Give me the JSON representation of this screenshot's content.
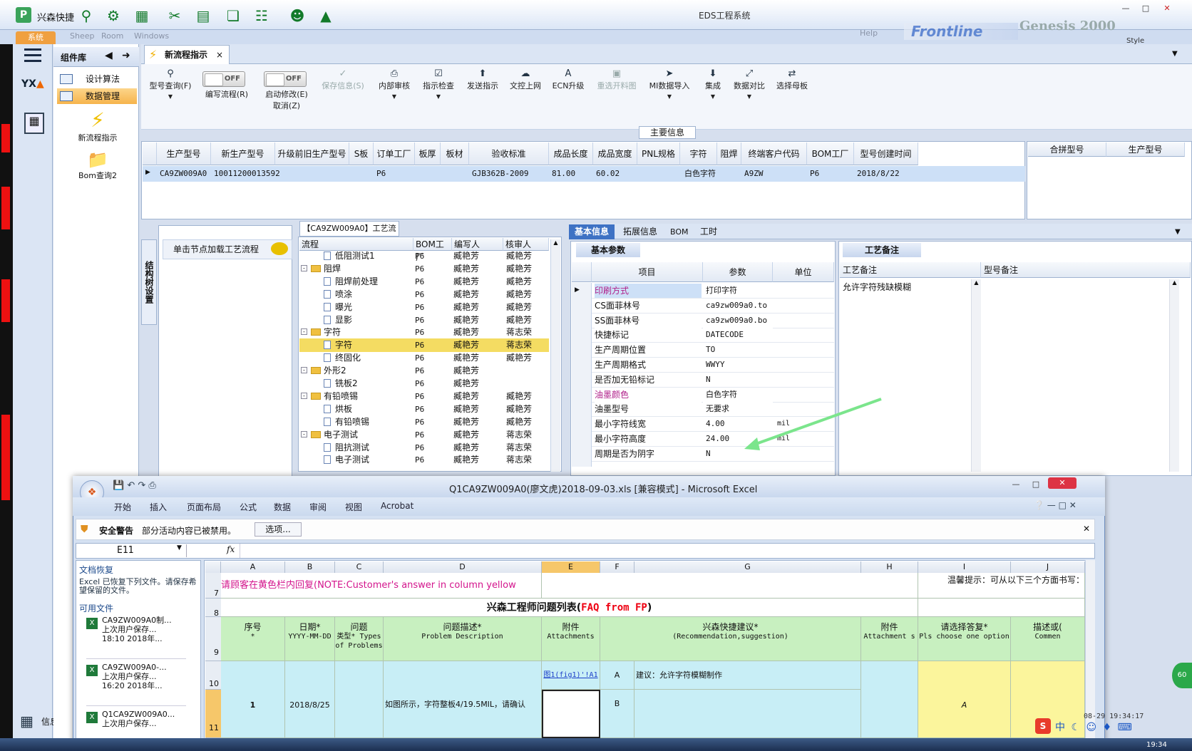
{
  "app": {
    "logo": "P",
    "name": "兴森快捷",
    "window_title": "EDS工程系统",
    "sys_tab": "系统",
    "menu_faded": [
      "Sheep",
      "Room",
      "Windows"
    ],
    "brand": "Frontline",
    "brand2": "Genesis 2000",
    "style_label": "Style",
    "user_faded": "Help"
  },
  "sidebar": {
    "panel_title": "组件库",
    "items": [
      "设计算法",
      "数据管理"
    ],
    "big_items": [
      "新流程指示",
      "Bom查询2"
    ],
    "bottom_label": "信息中心"
  },
  "tab": {
    "label": "新流程指示",
    "close": "×"
  },
  "toolbar": {
    "items": [
      {
        "label": "型号查询(F)",
        "icon": "search-icon"
      },
      {
        "label": "编写流程(R)",
        "toggle": "OFF"
      },
      {
        "label": "启动修改(E)",
        "sub": "取消(Z)",
        "toggle": "OFF"
      },
      {
        "label": "保存信息(S)",
        "icon": "check-icon",
        "disabled": true
      },
      {
        "label": "内部审核",
        "icon": "print-icon"
      },
      {
        "label": "指示检查",
        "icon": "check-icon"
      },
      {
        "label": "发送指示",
        "icon": "upload-icon"
      },
      {
        "label": "文控上网",
        "icon": "cloud-icon"
      },
      {
        "label": "ECN升级",
        "icon": "a-icon"
      },
      {
        "label": "重选开料图",
        "icon": "image-icon",
        "disabled": true
      },
      {
        "label": "MI数据导入",
        "icon": "import-icon"
      },
      {
        "label": "集成",
        "icon": "download-icon"
      },
      {
        "label": "数据对比",
        "icon": "compare-icon"
      },
      {
        "label": "选择母板",
        "icon": "shuffle-icon"
      }
    ]
  },
  "main_info": {
    "label": "主要信息",
    "columns": [
      "生产型号",
      "新生产型号",
      "升级前旧生产型号",
      "S板",
      "订单工厂",
      "板厚",
      "板材",
      "验收标准",
      "成品长度",
      "成品宽度",
      "PNL规格",
      "字符",
      "阻焊",
      "终端客户代码",
      "BOM工厂",
      "型号创建时间"
    ],
    "row": [
      "CA9ZW009A0",
      "10011200013592",
      "",
      "",
      "P6",
      "",
      "",
      "GJB362B-2009",
      "81.00",
      "60.02",
      "",
      "白色字符",
      "",
      "A9ZW",
      "P6",
      "2018/8/22"
    ],
    "right_columns": [
      "合拼型号",
      "生产型号"
    ]
  },
  "left_panel": {
    "vertical_label": "结构树设置",
    "load_text": "单击节点加载工艺流程"
  },
  "flow": {
    "title": "【CA9ZW009A0】工艺流程",
    "columns": [
      "流程",
      "BOM工厂",
      "编写人",
      "核审人"
    ],
    "rows": [
      {
        "name": "低阻测试1",
        "type": "doc",
        "indent": 2,
        "bom": "P6",
        "writer": "臧艳芳",
        "checker": "臧艳芳"
      },
      {
        "name": "阻焊",
        "type": "folder",
        "indent": 1,
        "bom": "P6",
        "writer": "臧艳芳",
        "checker": "臧艳芳"
      },
      {
        "name": "阻焊前处理",
        "type": "doc",
        "indent": 2,
        "bom": "P6",
        "writer": "臧艳芳",
        "checker": "臧艳芳"
      },
      {
        "name": "喷涂",
        "type": "doc",
        "indent": 2,
        "bom": "P6",
        "writer": "臧艳芳",
        "checker": "臧艳芳"
      },
      {
        "name": "曝光",
        "type": "doc",
        "indent": 2,
        "bom": "P6",
        "writer": "臧艳芳",
        "checker": "臧艳芳"
      },
      {
        "name": "显影",
        "type": "doc",
        "indent": 2,
        "bom": "P6",
        "writer": "臧艳芳",
        "checker": "臧艳芳"
      },
      {
        "name": "字符",
        "type": "folder",
        "indent": 1,
        "bom": "P6",
        "writer": "臧艳芳",
        "checker": "蒋志荣"
      },
      {
        "name": "字符",
        "type": "doc",
        "indent": 2,
        "bom": "P6",
        "writer": "臧艳芳",
        "checker": "蒋志荣",
        "selected": true
      },
      {
        "name": "终固化",
        "type": "doc",
        "indent": 2,
        "bom": "P6",
        "writer": "臧艳芳",
        "checker": "臧艳芳"
      },
      {
        "name": "外形2",
        "type": "folder",
        "indent": 1,
        "bom": "P6",
        "writer": "臧艳芳",
        "checker": ""
      },
      {
        "name": "铣板2",
        "type": "doc",
        "indent": 2,
        "bom": "P6",
        "writer": "臧艳芳",
        "checker": ""
      },
      {
        "name": "有铅喷锡",
        "type": "folder",
        "indent": 1,
        "bom": "P6",
        "writer": "臧艳芳",
        "checker": "臧艳芳"
      },
      {
        "name": "烘板",
        "type": "doc",
        "indent": 2,
        "bom": "P6",
        "writer": "臧艳芳",
        "checker": "臧艳芳"
      },
      {
        "name": "有铅喷锡",
        "type": "doc",
        "indent": 2,
        "bom": "P6",
        "writer": "臧艳芳",
        "checker": "臧艳芳"
      },
      {
        "name": "电子测试",
        "type": "folder",
        "indent": 1,
        "bom": "P6",
        "writer": "臧艳芳",
        "checker": "蒋志荣"
      },
      {
        "name": "阻抗测试",
        "type": "doc",
        "indent": 2,
        "bom": "P6",
        "writer": "臧艳芳",
        "checker": "蒋志荣"
      },
      {
        "name": "电子测试",
        "type": "doc",
        "indent": 2,
        "bom": "P6",
        "writer": "臧艳芳",
        "checker": "蒋志荣"
      }
    ]
  },
  "info_tabs": [
    "基本信息",
    "拓展信息",
    "BOM",
    "工时"
  ],
  "basic": {
    "title": "基本参数",
    "columns": [
      "项目",
      "参数",
      "单位"
    ],
    "rows": [
      {
        "k": "印刷方式",
        "v": "打印字符",
        "u": "",
        "pink": true
      },
      {
        "k": "CS面菲林号",
        "v": "ca9zw009a0.to",
        "u": ""
      },
      {
        "k": "SS面菲林号",
        "v": "ca9zw009a0.bo",
        "u": ""
      },
      {
        "k": "快捷标记",
        "v": "DATECODE",
        "u": ""
      },
      {
        "k": "生产周期位置",
        "v": "TO",
        "u": ""
      },
      {
        "k": "生产周期格式",
        "v": "WWYY",
        "u": ""
      },
      {
        "k": "是否加无铅标记",
        "v": "N",
        "u": ""
      },
      {
        "k": "油墨颜色",
        "v": "白色字符",
        "u": "",
        "pink": true
      },
      {
        "k": "油墨型号",
        "v": "无要求",
        "u": ""
      },
      {
        "k": "最小字符线宽",
        "v": "4.00",
        "u": "mil"
      },
      {
        "k": "最小字符高度",
        "v": "24.00",
        "u": "mil"
      },
      {
        "k": "周期是否为阴字",
        "v": "N",
        "u": ""
      }
    ]
  },
  "craft": {
    "title": "工艺备注",
    "columns": [
      "工艺备注",
      "型号备注"
    ],
    "note": "允许字符残缺模糊"
  },
  "excel": {
    "caption": "Q1CA9ZW009A0(廖文虎)2018-09-03.xls  [兼容模式] - Microsoft Excel",
    "ribbon_tabs": [
      "开始",
      "插入",
      "页面布局",
      "公式",
      "数据",
      "审阅",
      "视图",
      "Acrobat"
    ],
    "warning_label": "安全警告",
    "warning_text": "部分活动内容已被禁用。",
    "warning_button": "选项...",
    "name_box": "E11",
    "fx": "fx",
    "recovery_title": "文档恢复",
    "recovery_text": "Excel 已恢复下列文件。请保存希望保留的文件。",
    "available_label": "可用文件",
    "files": [
      {
        "name": "CA9ZW009A0制...",
        "note": "上次用户保存...",
        "time": "18:10 2018年..."
      },
      {
        "name": "CA9ZW009A0-...",
        "note": "上次用户保存...",
        "time": "16:20 2018年..."
      },
      {
        "name": "Q1CA9ZW009A0...",
        "note": "上次用户保存...",
        "time": ""
      }
    ],
    "col_letters": [
      "A",
      "B",
      "C",
      "D",
      "E",
      "F",
      "G",
      "H",
      "I",
      "J"
    ],
    "row7_text": "请顾客在黄色栏内回复(NOTE:Customer's answer in column yellow area)",
    "row7_right": "温馨提示：可从以下三个方面书写：",
    "row8_title": "兴森工程师问题列表(",
    "row8_title_red": "FAQ from FP",
    "row8_title_end": ")",
    "headers": [
      {
        "t": "序号",
        "s": "*"
      },
      {
        "t": "日期*",
        "s": "YYYY-MM-DD"
      },
      {
        "t": "问题",
        "s": "类型* Types of Problems"
      },
      {
        "t": "问题描述*",
        "s": "Problem Description"
      },
      {
        "t": "附件",
        "s": "Attachments"
      },
      {
        "t": "",
        "s": ""
      },
      {
        "t": "兴森快捷建议*",
        "s": "(Recommendation,suggestion)"
      },
      {
        "t": "附件",
        "s": "Attachment s"
      },
      {
        "t": "请选择答复*",
        "s": "Pls choose one option"
      },
      {
        "t": "描述或(",
        "s": "Commen"
      }
    ],
    "row10": {
      "attach": "图1(fig1)'!A1",
      "opt": "A",
      "suggestion": "建议：允许字符模糊制作"
    },
    "row11": {
      "no": "1",
      "date": "2018/8/25",
      "desc": "如图所示，字符整板4/19.5MIL，请确认",
      "opt": "B",
      "answer": "A"
    },
    "row_numbers": [
      "7",
      "8",
      "9",
      "10",
      "11"
    ]
  },
  "status": {
    "timestamp": "08-29 19:34:17",
    "clock": "19:34",
    "ime": "中"
  },
  "colors": {
    "accent_green": "#66e07a",
    "selected_row": "#f4dc62"
  }
}
